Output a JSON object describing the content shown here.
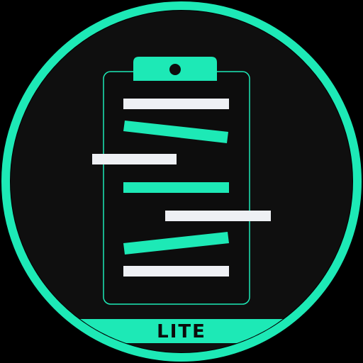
{
  "badge": {
    "label": "LITE"
  },
  "icon": {
    "name": "clipboard-icon"
  },
  "colors": {
    "background": "#000000",
    "disc": "#0f0f0f",
    "accent": "#1de9b6",
    "bar_light": "#eef0f4"
  }
}
